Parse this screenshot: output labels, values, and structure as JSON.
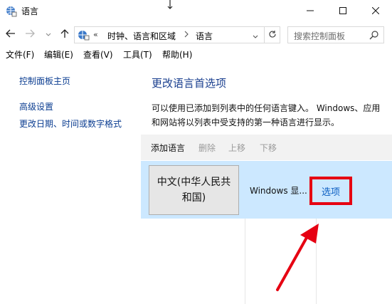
{
  "window": {
    "title": "语言",
    "controls": {
      "minimize": "minimize-icon",
      "maximize": "maximize-icon",
      "close": "close-icon"
    }
  },
  "navigation": {
    "overflow": "«",
    "breadcrumbs": [
      "时钟、语言和区域",
      "语言"
    ],
    "search_placeholder": "搜索控制面板"
  },
  "menubar": {
    "items": [
      "文件(F)",
      "编辑(E)",
      "查看(V)",
      "工具(T)",
      "帮助(H)"
    ]
  },
  "sidebar": {
    "links": [
      "控制面板主页",
      "高级设置",
      "更改日期、时间或数字格式"
    ]
  },
  "main": {
    "title": "更改语言首选项",
    "description": "可以使用已添加到列表中的任何语言键入。 Windows、应用和网站将以列表中受支持的第一种语言进行显示。",
    "toolbar": {
      "add": "添加语言",
      "remove": "删除",
      "move_up": "上移",
      "move_down": "下移"
    },
    "languages": [
      {
        "name": "中文(中华人民共和国)",
        "status": "Windows 显...",
        "options": "选项"
      }
    ]
  },
  "colors": {
    "link": "#0b3d91",
    "selection": "#cce8ff",
    "highlight_box": "#e60012",
    "annotation_arrow": "#e60012"
  }
}
